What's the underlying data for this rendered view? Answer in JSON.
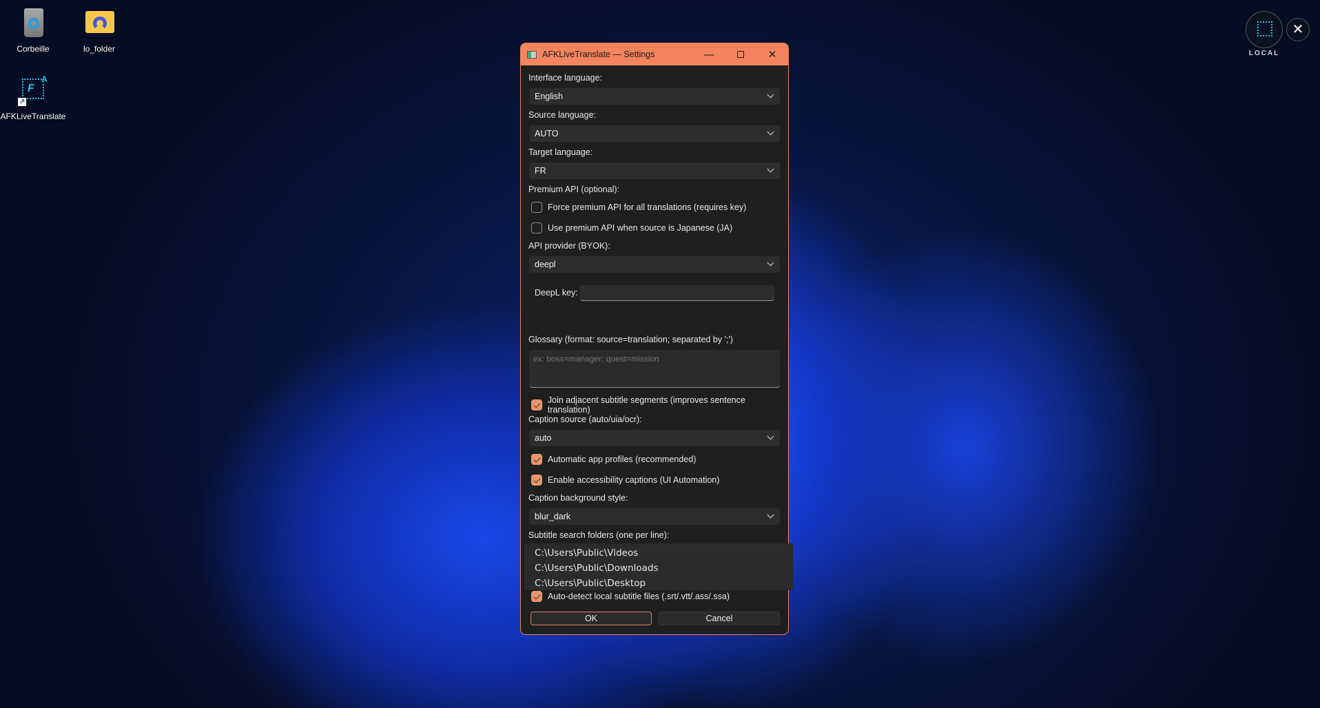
{
  "desktop": {
    "icons": [
      {
        "label": "Corbeille",
        "icon": "recycle-bin-icon"
      },
      {
        "label": "lo_folder",
        "icon": "folder-icon"
      },
      {
        "label": "AFKLiveTranslate",
        "icon": "app-shortcut-icon"
      }
    ]
  },
  "overlay": {
    "badge_label": "LOCAL",
    "close": "close-icon"
  },
  "window": {
    "title": "AFKLiveTranslate — Settings",
    "accent": "#f4845d"
  },
  "form": {
    "interface_language": {
      "label": "Interface language:",
      "value": "English"
    },
    "source_language": {
      "label": "Source language:",
      "value": "AUTO"
    },
    "target_language": {
      "label": "Target language:",
      "value": "FR"
    },
    "premium_label": "Premium API (optional):",
    "force_premium": {
      "label": "Force premium API for all translations (requires key)",
      "checked": false
    },
    "premium_ja": {
      "label": "Use premium API when source is Japanese (JA)",
      "checked": false
    },
    "api_provider": {
      "label": "API provider (BYOK):",
      "value": "deepl"
    },
    "deepl_key": {
      "label": "DeepL key:",
      "value": ""
    },
    "glossary": {
      "label": "Glossary (format: source=translation; separated by ';')",
      "placeholder": "ex: boss=manager; quest=mission",
      "value": ""
    },
    "join_segments": {
      "label": "Join adjacent subtitle segments (improves sentence translation)",
      "checked": true
    },
    "caption_source": {
      "label": "Caption source (auto/uia/ocr):",
      "value": "auto"
    },
    "auto_profiles": {
      "label": "Automatic app profiles (recommended)",
      "checked": true
    },
    "accessibility": {
      "label": "Enable accessibility captions (UI Automation)",
      "checked": true
    },
    "caption_bg": {
      "label": "Caption background style:",
      "value": "blur_dark"
    },
    "subtitle_folders": {
      "label": "Subtitle search folders (one per line):",
      "lines": [
        "C:\\Users\\Public\\Videos",
        "C:\\Users\\Public\\Downloads",
        "C:\\Users\\Public\\Desktop"
      ]
    },
    "autodetect": {
      "label": "Auto-detect local subtitle files (.srt/.vtt/.ass/.ssa)",
      "checked": true
    }
  },
  "buttons": {
    "ok": "OK",
    "cancel": "Cancel"
  }
}
